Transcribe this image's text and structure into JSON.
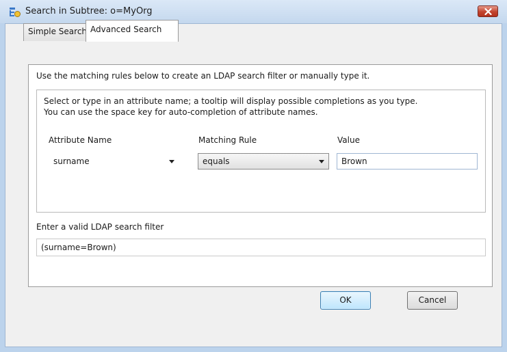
{
  "window": {
    "title": "Search in Subtree: o=MyOrg",
    "close_icon": "close-icon"
  },
  "tabs": [
    {
      "label": "Simple Search",
      "selected": false
    },
    {
      "label": "Advanced Search",
      "selected": true
    }
  ],
  "advanced": {
    "description": "Use the matching rules below to create an LDAP search filter or manually type it.",
    "hint_line1": "Select or type in an attribute name; a tooltip will display possible completions as you type.",
    "hint_line2": "You can use the space key for auto-completion of attribute names.",
    "columns": {
      "attribute": "Attribute Name",
      "rule": "Matching Rule",
      "value": "Value"
    },
    "row": {
      "attribute": "surname",
      "rule": "equals",
      "value": "Brown"
    },
    "filter_label": "Enter a valid LDAP search filter",
    "filter_value": "(surname=Brown)"
  },
  "buttons": {
    "ok": "OK",
    "cancel": "Cancel"
  }
}
